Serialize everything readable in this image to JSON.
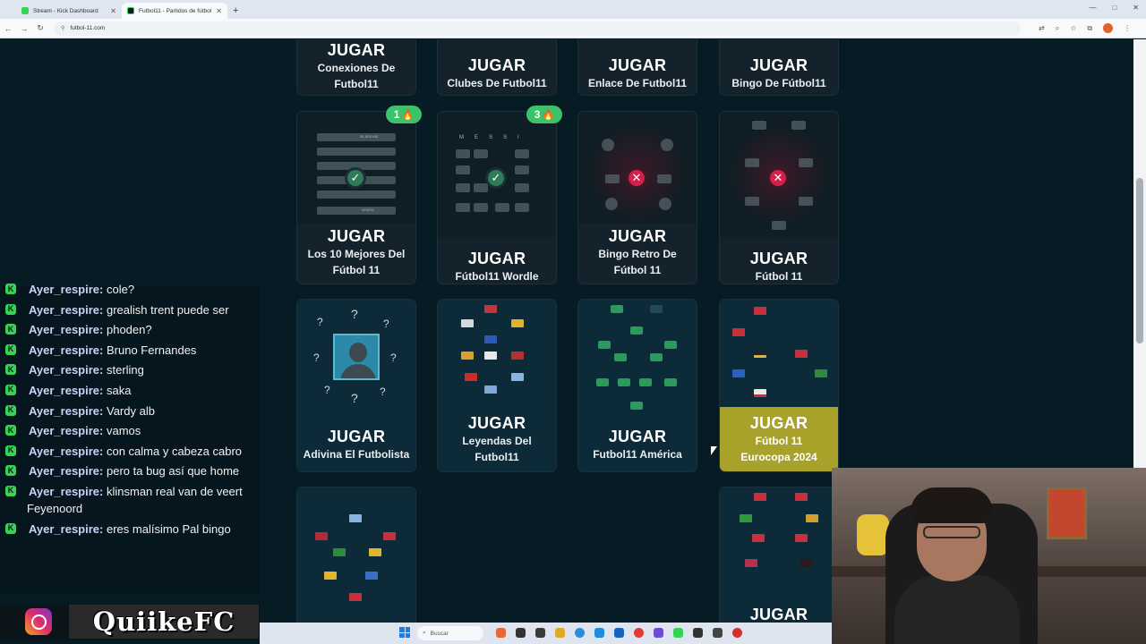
{
  "browser": {
    "tabs": [
      {
        "label": "Stream - Kick Dashboard",
        "icon": "kick-icon",
        "color": "#39d353",
        "active": false
      },
      {
        "label": "Futbol11 - Partidos de fútbol d",
        "icon": "futbol11-icon",
        "color": "#0b1d24",
        "active": true
      }
    ],
    "url": "futbol-11.com"
  },
  "cards": [
    {
      "jugar": "JUGAR",
      "title": "Conexiones De Futbol11"
    },
    {
      "jugar": "JUGAR",
      "title": "Clubes De Futbol11"
    },
    {
      "jugar": "JUGAR",
      "title": "Enlace De Futbol11"
    },
    {
      "jugar": "JUGAR",
      "title": "Bingo De Fútbol11"
    },
    {
      "jugar": "JUGAR",
      "title": "Los 10 Mejores Del Fútbol 11",
      "badge": "1",
      "status": "completed"
    },
    {
      "jugar": "JUGAR",
      "title": "Fútbol11 Wordle",
      "badge": "3",
      "status": "completed"
    },
    {
      "jugar": "JUGAR",
      "title": "Bingo Retro De Fútbol 11",
      "status": "failed"
    },
    {
      "jugar": "JUGAR",
      "title": "Fútbol 11",
      "status": "failed"
    },
    {
      "jugar": "JUGAR",
      "title": "Adivina El Futbolista"
    },
    {
      "jugar": "JUGAR",
      "title": "Leyendas Del Futbol11"
    },
    {
      "jugar": "JUGAR",
      "title": "Futbol11 América"
    },
    {
      "jugar": "JUGAR",
      "title": "Fútbol 11 Eurocopa 2024"
    },
    {
      "jugar": "",
      "title": ""
    },
    {
      "jugar": "JUGAR",
      "title": ""
    }
  ],
  "thumb_text": {
    "top10_top": "DE BRUYNE",
    "top10_bottom": "MODRIC",
    "wordle_row": [
      "M",
      "E",
      "S",
      "S",
      "I"
    ],
    "mystery": "?"
  },
  "chat": [
    {
      "user": "Ayer_respire:",
      "text": "cole?"
    },
    {
      "user": "Ayer_respire:",
      "text": "grealish trent puede ser"
    },
    {
      "user": "Ayer_respire:",
      "text": "phoden?"
    },
    {
      "user": "Ayer_respire:",
      "text": "Bruno Fernandes"
    },
    {
      "user": "Ayer_respire:",
      "text": "sterling"
    },
    {
      "user": "Ayer_respire:",
      "text": "saka"
    },
    {
      "user": "Ayer_respire:",
      "text": "Vardy alb"
    },
    {
      "user": "Ayer_respire:",
      "text": "vamos"
    },
    {
      "user": "Ayer_respire:",
      "text": "con calma y cabeza cabro"
    },
    {
      "user": "Ayer_respire:",
      "text": "pero ta bug así que home"
    },
    {
      "user": "Ayer_respire:",
      "text": "klinsman real van de veert Feyenoord"
    },
    {
      "user": "Ayer_respire:",
      "text": "eres malísimo Pal bingo"
    }
  ],
  "overlay": {
    "brand": "QuiikeFC"
  },
  "taskbar": {
    "search_placeholder": "Buscar"
  },
  "colors": {
    "page_bg": "#071b24",
    "badge": "#3cc36a",
    "success": "#2f7a5a",
    "fail": "#d3204d",
    "eurocopa": "#a8a12a"
  }
}
